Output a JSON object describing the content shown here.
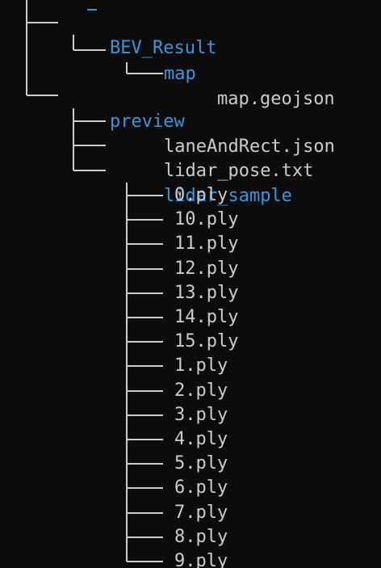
{
  "terminal": {
    "background": "#0c0c0c",
    "directory_color": "#3a96dd",
    "file_color": "#cccccc"
  },
  "tree": {
    "bev_result": "BEV_Result",
    "map_dir": "map",
    "map_file": "map.geojson",
    "preview_dir": "preview",
    "lane_file": "laneAndRect.json",
    "pose_file": "lidar_pose.txt",
    "sample_dir": "lidar_sample",
    "samples": [
      "0.ply",
      "10.ply",
      "11.ply",
      "12.ply",
      "13.ply",
      "14.ply",
      "15.ply",
      "1.ply",
      "2.ply",
      "3.ply",
      "4.ply",
      "5.ply",
      "6.ply",
      "7.ply",
      "8.ply",
      "9.ply"
    ]
  }
}
